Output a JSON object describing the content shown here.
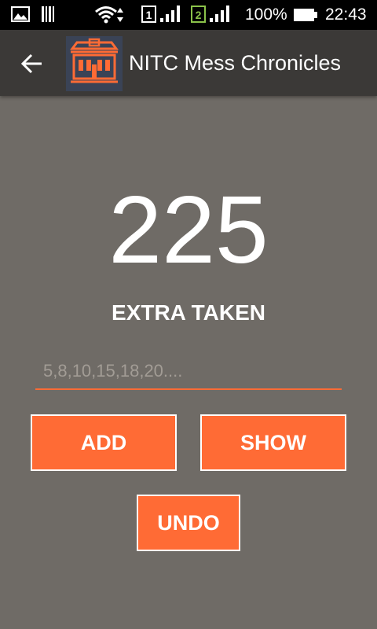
{
  "status_bar": {
    "battery": "100%",
    "time": "22:43",
    "sim1": "1",
    "sim2": "2",
    "icons": [
      "gallery-icon",
      "barcode-icon",
      "wifi-icon",
      "sim1-signal-icon",
      "sim2-signal-icon",
      "battery-icon"
    ]
  },
  "toolbar": {
    "title": "NITC Mess Chronicles",
    "back_icon": "arrow-left-icon",
    "logo_icon": "building-icon"
  },
  "main": {
    "counter": "225",
    "counter_label": "EXTRA TAKEN",
    "input": {
      "value": "",
      "placeholder": "5,8,10,15,18,20...."
    },
    "buttons": {
      "add": "ADD",
      "show": "SHOW",
      "undo": "UNDO"
    }
  },
  "colors": {
    "accent": "#ff6b35",
    "background": "#6f6b66",
    "toolbar": "#3b3937",
    "status_bar": "#000000"
  }
}
